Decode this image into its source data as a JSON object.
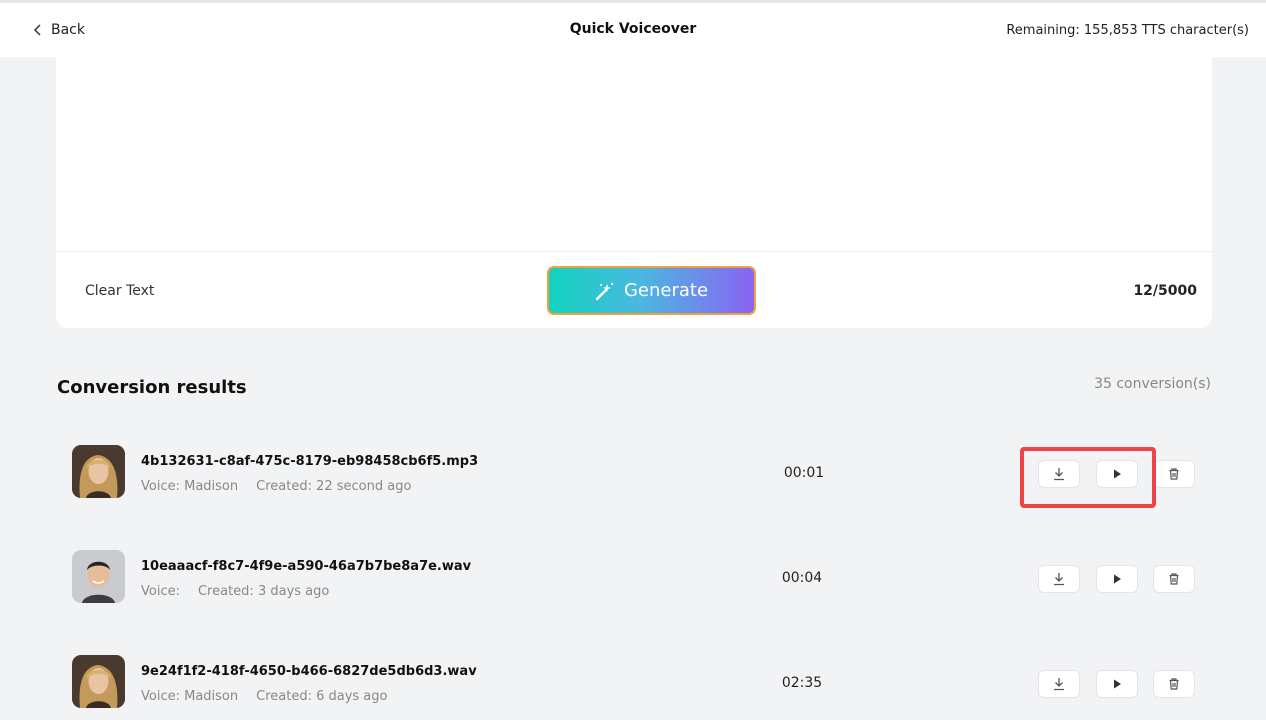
{
  "header": {
    "back_label": "Back",
    "title": "Quick Voiceover",
    "remaining": "Remaining: 155,853 TTS character(s)"
  },
  "editor": {
    "clear_label": "Clear Text",
    "generate_label": "Generate",
    "char_count": "12/5000"
  },
  "results": {
    "title": "Conversion results",
    "count": "35 conversion(s)",
    "items": [
      {
        "filename": "4b132631-c8af-475c-8179-eb98458cb6f5.mp3",
        "voice": "Voice: Madison",
        "created": "Created: 22 second ago",
        "duration": "00:01",
        "avatar": "female-avatar"
      },
      {
        "filename": "10eaaacf-f8c7-4f9e-a590-46a7b7be8a7e.wav",
        "voice": "Voice:",
        "created": "Created: 3 days ago",
        "duration": "00:04",
        "avatar": "male-avatar"
      },
      {
        "filename": "9e24f1f2-418f-4650-b466-6827de5db6d3.wav",
        "voice": "Voice: Madison",
        "created": "Created: 6 days ago",
        "duration": "02:35",
        "avatar": "female-avatar"
      }
    ]
  },
  "icons": {
    "back": "chevron-left-icon",
    "generate": "magic-wand-icon",
    "download": "download-icon",
    "play": "play-icon",
    "delete": "trash-icon"
  },
  "colors": {
    "gradient_start": "#12d3c0",
    "gradient_end": "#8a63f3",
    "generate_border": "#f0a23a",
    "highlight": "#ee4444"
  }
}
